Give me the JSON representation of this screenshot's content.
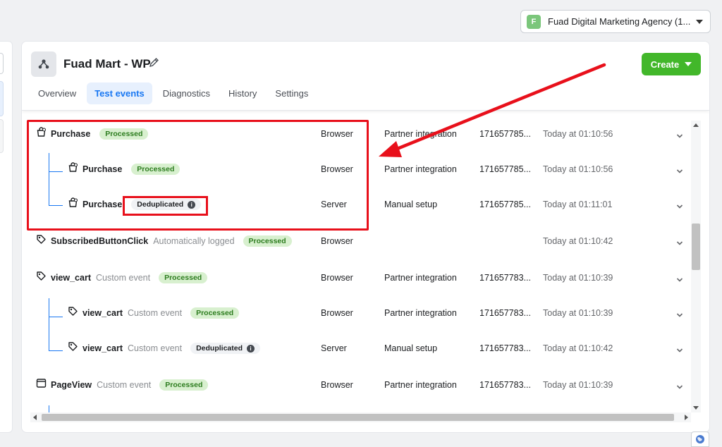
{
  "account": {
    "avatar_letter": "F",
    "name": "Fuad Digital Marketing Agency (1..."
  },
  "pixel": {
    "title": "Fuad Mart - WP"
  },
  "create_label": "Create",
  "tabs": [
    "Overview",
    "Test events",
    "Diagnostics",
    "History",
    "Settings"
  ],
  "active_tab": "Test events",
  "rows": [
    {
      "icon": "cart-icon",
      "name": "Purchase",
      "sub": "",
      "badge": "Processed",
      "badge_type": "processed",
      "source": "Browser",
      "integration": "Partner integration",
      "id": "171657785...",
      "time": "Today at 01:10:56"
    },
    {
      "icon": "cart-icon",
      "name": "Purchase",
      "sub": "",
      "badge": "Processed",
      "badge_type": "processed",
      "source": "Browser",
      "integration": "Partner integration",
      "id": "171657785...",
      "time": "Today at 01:10:56"
    },
    {
      "icon": "cart-icon",
      "name": "Purchase",
      "sub": "",
      "badge": "Deduplicated",
      "badge_type": "dedup",
      "source": "Server",
      "integration": "Manual setup",
      "id": "171657785...",
      "time": "Today at 01:11:01"
    },
    {
      "icon": "tag-icon",
      "name": "SubscribedButtonClick",
      "sub": "Automatically logged",
      "badge": "Processed",
      "badge_type": "processed",
      "source": "Browser",
      "integration": "",
      "id": "",
      "time": "Today at 01:10:42"
    },
    {
      "icon": "tag-icon",
      "name": "view_cart",
      "sub": "Custom event",
      "badge": "Processed",
      "badge_type": "processed",
      "source": "Browser",
      "integration": "Partner integration",
      "id": "171657783...",
      "time": "Today at 01:10:39"
    },
    {
      "icon": "tag-icon",
      "name": "view_cart",
      "sub": "Custom event",
      "badge": "Processed",
      "badge_type": "processed",
      "source": "Browser",
      "integration": "Partner integration",
      "id": "171657783...",
      "time": "Today at 01:10:39"
    },
    {
      "icon": "tag-icon",
      "name": "view_cart",
      "sub": "Custom event",
      "badge": "Deduplicated",
      "badge_type": "dedup",
      "source": "Server",
      "integration": "Manual setup",
      "id": "171657783...",
      "time": "Today at 01:10:42"
    },
    {
      "icon": "page-icon",
      "name": "PageView",
      "sub": "Custom event",
      "badge": "Processed",
      "badge_type": "processed",
      "source": "Browser",
      "integration": "Partner integration",
      "id": "171657783...",
      "time": "Today at 01:10:39"
    }
  ],
  "colors": {
    "accent": "#1877f2",
    "create": "#42b72a",
    "processed_bg": "#d8f0cf",
    "annotation": "#e8101b"
  }
}
